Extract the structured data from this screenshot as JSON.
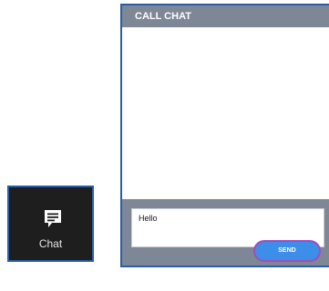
{
  "chat_toggle": {
    "icon": "chat-bubble-icon",
    "label": "Chat"
  },
  "chat_panel": {
    "title": "CALL CHAT",
    "message_value": "Hello",
    "send_label": "SEND"
  },
  "colors": {
    "header_bg": "#7e8796",
    "toggle_bg": "#1e1e1e",
    "border_blue": "#2a5fa8",
    "send_bg": "#3d8ee8",
    "send_outline": "#a54bbb"
  }
}
